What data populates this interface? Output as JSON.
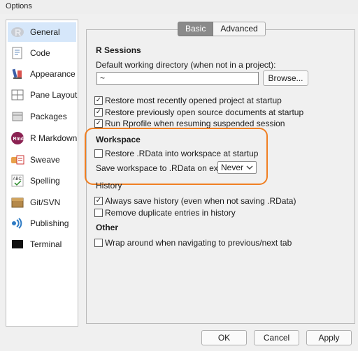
{
  "window": {
    "title": "Options"
  },
  "sidebar": {
    "items": [
      {
        "label": "General",
        "icon": "r-logo-icon",
        "selected": true
      },
      {
        "label": "Code",
        "icon": "code-icon",
        "selected": false
      },
      {
        "label": "Appearance",
        "icon": "appearance-icon",
        "selected": false
      },
      {
        "label": "Pane Layout",
        "icon": "pane-layout-icon",
        "selected": false
      },
      {
        "label": "Packages",
        "icon": "packages-icon",
        "selected": false
      },
      {
        "label": "R Markdown",
        "icon": "rmarkdown-icon",
        "icon_text": "Rmd",
        "selected": false
      },
      {
        "label": "Sweave",
        "icon": "sweave-icon",
        "selected": false
      },
      {
        "label": "Spelling",
        "icon": "spelling-icon",
        "icon_text": "ABC",
        "selected": false
      },
      {
        "label": "Git/SVN",
        "icon": "git-icon",
        "selected": false
      },
      {
        "label": "Publishing",
        "icon": "publishing-icon",
        "selected": false
      },
      {
        "label": "Terminal",
        "icon": "terminal-icon",
        "selected": false
      }
    ]
  },
  "tabs": [
    {
      "label": "Basic",
      "active": true
    },
    {
      "label": "Advanced",
      "active": false
    }
  ],
  "r_sessions": {
    "heading": "R Sessions",
    "dir_label": "Default working directory (when not in a project):",
    "dir_value": "~",
    "browse_label": "Browse...",
    "options": [
      {
        "label": "Restore most recently opened project at startup",
        "checked": true
      },
      {
        "label": "Restore previously open source documents at startup",
        "checked": true
      },
      {
        "label": "Run Rprofile when resuming suspended session",
        "checked": true
      }
    ]
  },
  "workspace": {
    "heading": "Workspace",
    "restore_label": "Restore .RData into workspace at startup",
    "restore_checked": false,
    "save_label": "Save workspace to .RData on exit:",
    "save_value": "Never"
  },
  "history": {
    "heading": "History",
    "options": [
      {
        "label": "Always save history (even when not saving .RData)",
        "checked": true
      },
      {
        "label": "Remove duplicate entries in history",
        "checked": false
      }
    ]
  },
  "other": {
    "heading": "Other",
    "options": [
      {
        "label": "Wrap around when navigating to previous/next tab",
        "checked": false
      }
    ]
  },
  "footer": {
    "ok_label": "OK",
    "cancel_label": "Cancel",
    "apply_label": "Apply"
  },
  "colors": {
    "highlight": "#f07f22",
    "selected_bg": "#d6e7fa",
    "tab_active": "#8a8a8a"
  }
}
